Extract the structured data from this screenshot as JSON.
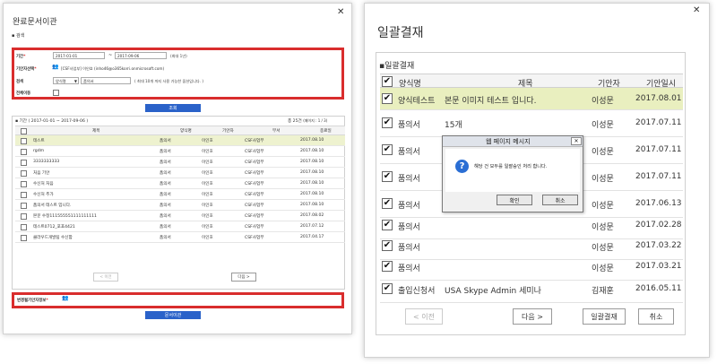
{
  "left": {
    "title": "완료문서이관",
    "search_section": "검색",
    "period_label": "기간",
    "period_start": "2017-01-01",
    "period_tilde": "~",
    "period_end": "2017-09-06",
    "period_hint": "(최대 1년)",
    "drafter_label": "기안자선택",
    "drafter_value": "[CSF사업부] 이인호 (inho46@o365korri.onmicrosoft.com)",
    "search_label": "검색",
    "search_select": "양식명",
    "search_value": "품의서",
    "search_hint": "( 최대 10개 까지 사용 가능한 옵션입니다. )",
    "all_label": "전체이동",
    "query_button": "조회",
    "result_section": "기간 ( 2017-01-01 ~ 2017-09-06 )",
    "total": "총 25건",
    "page_info": "(페이지 : 1 / 3)",
    "columns": [
      "제목",
      "양식명",
      "기안자",
      "부서",
      "종료일"
    ],
    "rows": [
      [
        "테스트",
        "품의서",
        "이인호",
        "CSF사업부",
        "2017.08.10"
      ],
      [
        "rgdm",
        "품의서",
        "이인호",
        "CSF사업부",
        "2017.08.10"
      ],
      [
        "3333333333",
        "품의서",
        "이인호",
        "CSF사업부",
        "2017.08.10"
      ],
      [
        "처음 기안",
        "품의서",
        "이인호",
        "CSF사업부",
        "2017.08.10"
      ],
      [
        "수신처 처음",
        "품의서",
        "이인호",
        "CSF사업부",
        "2017.08.10"
      ],
      [
        "수신처 추가",
        "품의서",
        "이인호",
        "CSF사업부",
        "2017.08.10"
      ],
      [
        "품의서 테스트 입니다.",
        "품의서",
        "이인호",
        "CSF사업부",
        "2017.08.10"
      ],
      [
        "본문 수정111555551111111111",
        "품의서",
        "이인호",
        "CSF사업부",
        "2017.08.02"
      ],
      [
        "테스트0712_포포4421",
        "품의서",
        "이인호",
        "CSF사업부",
        "2017.07.12"
      ],
      [
        "클라우드개발팀 수신함",
        "품의서",
        "이인호",
        "CSF사업부",
        "2017.04.17"
      ]
    ],
    "prev": "< 이전",
    "next": "다음 >",
    "changer_label": "변경될기안자정보",
    "move_button": "문서이관"
  },
  "right": {
    "title": "일괄결재",
    "section": "일괄결재",
    "columns": [
      "양식명",
      "제목",
      "기안자",
      "기안일시"
    ],
    "rows": [
      [
        "양식테스트",
        "본문 이미지 테스트 입니다.",
        "이성문",
        "2017.08.01"
      ],
      [
        "품의서",
        "15개",
        "이성문",
        "2017.07.11"
      ],
      [
        "품의서",
        "",
        "이성문",
        "2017.07.11"
      ],
      [
        "품의서",
        "",
        "이성문",
        "2017.07.11"
      ],
      [
        "품의서",
        "",
        "이성문",
        "2017.06.13"
      ],
      [
        "품의서",
        "",
        "이성문",
        "2017.02.28"
      ],
      [
        "품의서",
        "",
        "이성문",
        "2017.03.22"
      ],
      [
        "품의서",
        "",
        "이성문",
        "2017.03.21"
      ],
      [
        "출입신청서",
        "USA Skype Admin 세미나",
        "김재훈",
        "2016.05.11"
      ]
    ],
    "prev": "< 이전",
    "next": "다음 >",
    "approve": "일괄결재",
    "cancel": "취소",
    "dialog": {
      "title": "웹 페이지 메시지",
      "message": "해당 건 모두를 일괄승인 처리 합니다.",
      "ok": "확인",
      "cancel": "취소"
    }
  },
  "colors": {
    "red": "#d92d2d",
    "blue": "#2a62c9",
    "highlight": "#e9efbf"
  }
}
